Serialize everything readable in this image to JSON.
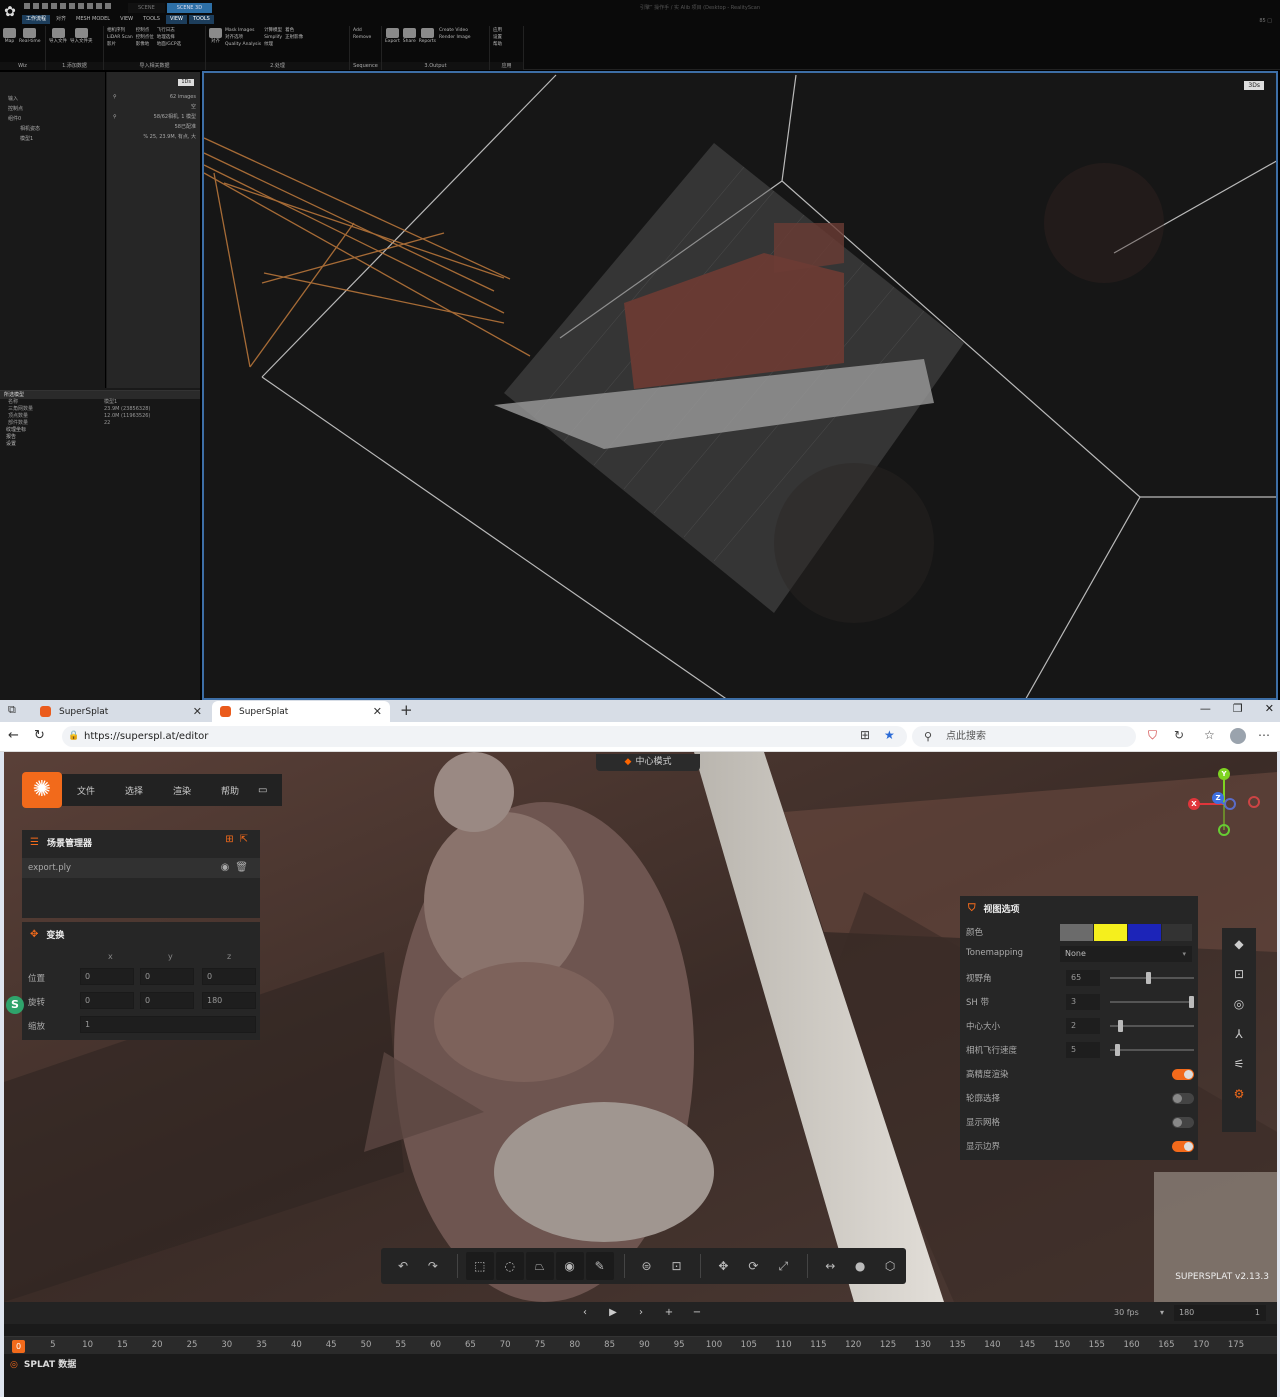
{
  "top_app": {
    "scene_tabs": [
      "SCENE",
      "SCENE 3D"
    ],
    "title": "引擎” 操作手 / 实 Alib 项目 (Desktop - RealityScan",
    "corner": "85 □",
    "menu_tabs": [
      "工作流程",
      "对齐",
      "MESH MODEL",
      "VIEW",
      "TOOLS",
      "VIEW",
      "TOOLS"
    ],
    "groups": [
      {
        "label": "Wiz",
        "buttons": [
          "Map",
          "Real-time",
          "Wizard Assistance"
        ]
      },
      {
        "label": "1.添加数据",
        "buttons": [
          "导入文件",
          "导入文件夹"
        ]
      },
      {
        "label": "导入相关数据",
        "col1": [
          "相机序列",
          "LiDAR Scan",
          "影片"
        ],
        "col2": [
          "控制点",
          "控制点位",
          "影像地"
        ],
        "col3": [
          "飞行日志",
          "地理选择",
          "地面/GCP选"
        ]
      },
      {
        "label": "2.处理",
        "buttons": [
          "对齐"
        ],
        "col1": [
          "Mask Images",
          "对齐选项",
          "Quality Analysis"
        ],
        "col2": [
          "计算模型",
          "Simplify",
          "纹理"
        ],
        "col3": [
          "着色",
          "正射影像",
          ""
        ]
      },
      {
        "label": "Sequence",
        "col1": [
          "Add",
          "Remove"
        ]
      },
      {
        "label": "3.Output",
        "buttons": [
          "Export",
          "Share",
          "Reports"
        ],
        "col1": [
          "Create Video",
          "Render Image"
        ]
      },
      {
        "label": "应用",
        "col1": [
          "应用",
          "设置",
          "帮助"
        ]
      }
    ],
    "tree": {
      "badge": "1Ds",
      "items": [
        "输入",
        "控制点",
        "组件0",
        "相机姿态",
        "模型1"
      ],
      "info": [
        {
          "left": "⚲",
          "right": "62 images"
        },
        {
          "left": "",
          "right": "空"
        },
        {
          "left": "⚲",
          "right": "58/62相机, 1 模型"
        },
        {
          "left": "",
          "right": "58已配准"
        },
        {
          "left": "",
          "right": "% 25, 23.9M, 有点, 大"
        }
      ]
    },
    "props": {
      "title": "所选模型",
      "rows": [
        {
          "label": "名称",
          "value": "模型1"
        },
        {
          "label": "三角网数量",
          "value": "23.9M (23856328)"
        },
        {
          "label": "顶点数量",
          "value": "12.0M (11963526)"
        },
        {
          "label": "部件数量",
          "value": "22"
        }
      ],
      "list": [
        "纹理坐标",
        "报告",
        "设置"
      ]
    },
    "viewport_badge": "3Ds"
  },
  "browser": {
    "tabs": [
      {
        "label": "SuperSplat"
      },
      {
        "label": "SuperSplat"
      }
    ],
    "new_tab": "+",
    "url": "https://superspl.at/editor",
    "search_placeholder": "点此搜索"
  },
  "editor": {
    "mode": "中心模式",
    "menu": [
      "文件",
      "选择",
      "渲染",
      "帮助"
    ],
    "scene_manager": {
      "title": "场景管理器",
      "model": "export.ply"
    },
    "transform": {
      "title": "变换",
      "axes": [
        "x",
        "y",
        "z"
      ],
      "rows": [
        {
          "label": "位置",
          "x": "0",
          "y": "0",
          "z": "0"
        },
        {
          "label": "旋转",
          "x": "0",
          "y": "0",
          "z": "180"
        },
        {
          "label": "缩放",
          "value": "1"
        }
      ]
    },
    "view_options": {
      "title": "视图选项",
      "color_label": "颜色",
      "swatch_colors": [
        "#6b6b6b",
        "#f5ef1d",
        "#1c24b8"
      ],
      "tonemapping_label": "Tonemapping",
      "tonemapping": "None",
      "sliders": [
        {
          "label": "视野角",
          "value": "65",
          "pos": 0.45
        },
        {
          "label": "SH 带",
          "value": "3",
          "pos": 1.0
        },
        {
          "label": "中心大小",
          "value": "2",
          "pos": 0.1
        },
        {
          "label": "相机飞行速度",
          "value": "5",
          "pos": 0.06
        }
      ],
      "toggles": [
        {
          "label": "高精度渲染",
          "on": true
        },
        {
          "label": "轮廓选择",
          "on": false
        },
        {
          "label": "显示网格",
          "on": false
        },
        {
          "label": "显示边界",
          "on": true
        }
      ]
    },
    "gizmo": {
      "y": "Y",
      "x": "X",
      "z": "Z"
    },
    "splat_badge": "S",
    "version": "SUPERSPLAT v2.13.3",
    "timeline": {
      "fps": "30 fps",
      "frames": "180",
      "frame_step": "1",
      "ticks": [
        0,
        5,
        10,
        15,
        20,
        25,
        30,
        35,
        40,
        45,
        50,
        55,
        60,
        65,
        70,
        75,
        80,
        85,
        90,
        95,
        100,
        105,
        110,
        115,
        120,
        125,
        130,
        135,
        140,
        145,
        150,
        155,
        160,
        165,
        170,
        175
      ],
      "track_label": "SPLAT 数据"
    },
    "accent": "#f26a1b"
  }
}
